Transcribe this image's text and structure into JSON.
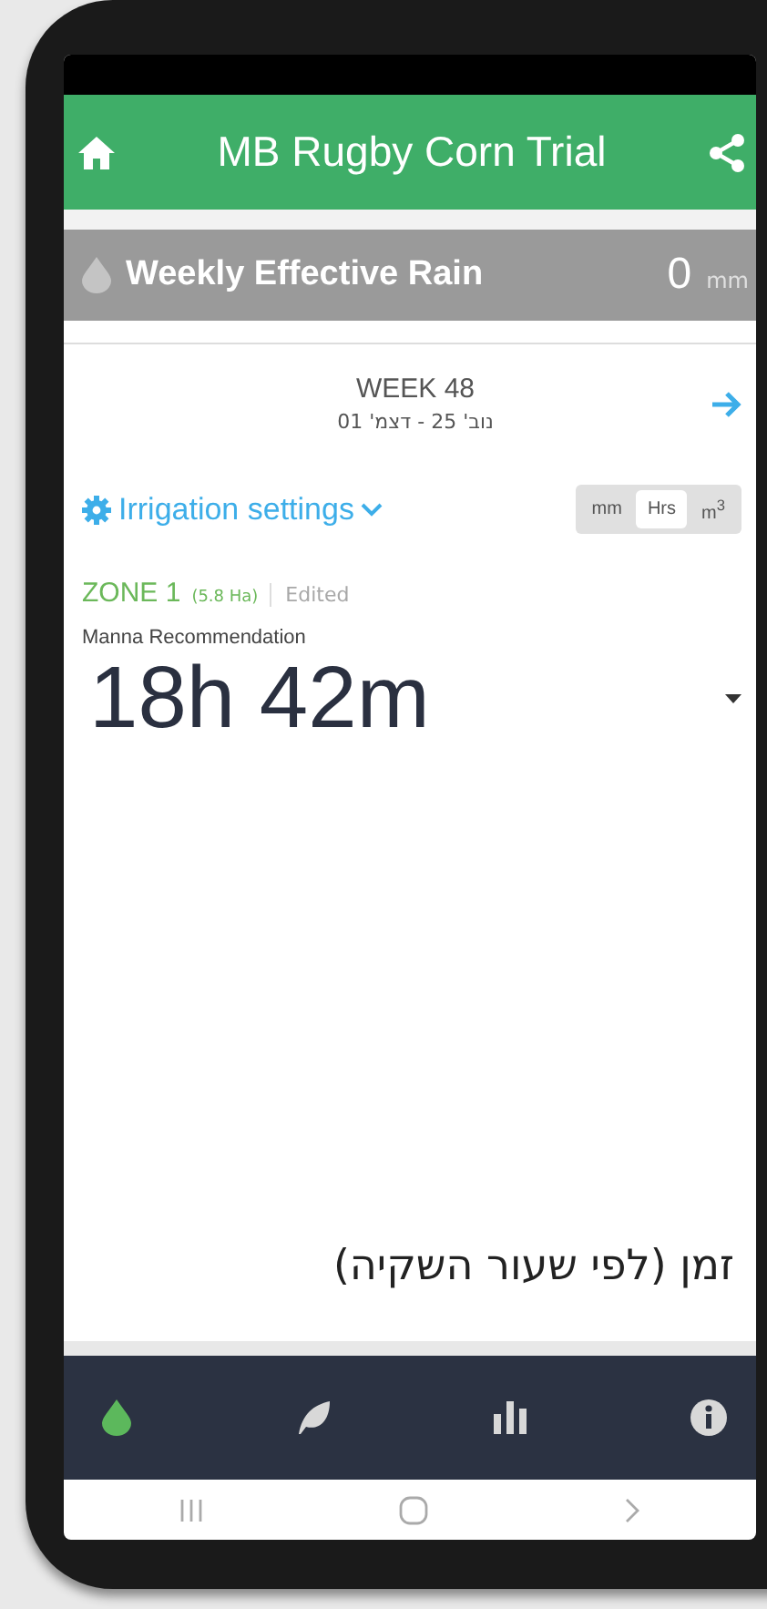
{
  "header": {
    "title": "MB Rugby Corn Trial"
  },
  "rain": {
    "label": "Weekly Effective Rain",
    "value": "0",
    "unit": "mm"
  },
  "week": {
    "title": "WEEK 48",
    "dates": "נוב' 25 - דצמ' 01"
  },
  "settings": {
    "label": "Irrigation settings"
  },
  "units": [
    {
      "label": "mm",
      "selected": false
    },
    {
      "label": "Hrs",
      "selected": true
    },
    {
      "label": "m$^{3}$",
      "selected": false
    }
  ],
  "zone": {
    "name": "ZONE 1",
    "area": "(5.8 Ha)",
    "status": "Edited"
  },
  "recommendation": {
    "label": "Manna Recommendation",
    "value": "18h 42m"
  },
  "caption": "זמן (לפי שעור השקיה)",
  "nav": [
    {
      "kind": "drop",
      "selected": true
    },
    {
      "kind": "leaf",
      "selected": false
    },
    {
      "kind": "chart",
      "selected": false
    },
    {
      "kind": "info",
      "selected": false
    }
  ],
  "system_nav": [
    {
      "kind": "recents"
    },
    {
      "kind": "home"
    },
    {
      "kind": "back"
    }
  ]
}
